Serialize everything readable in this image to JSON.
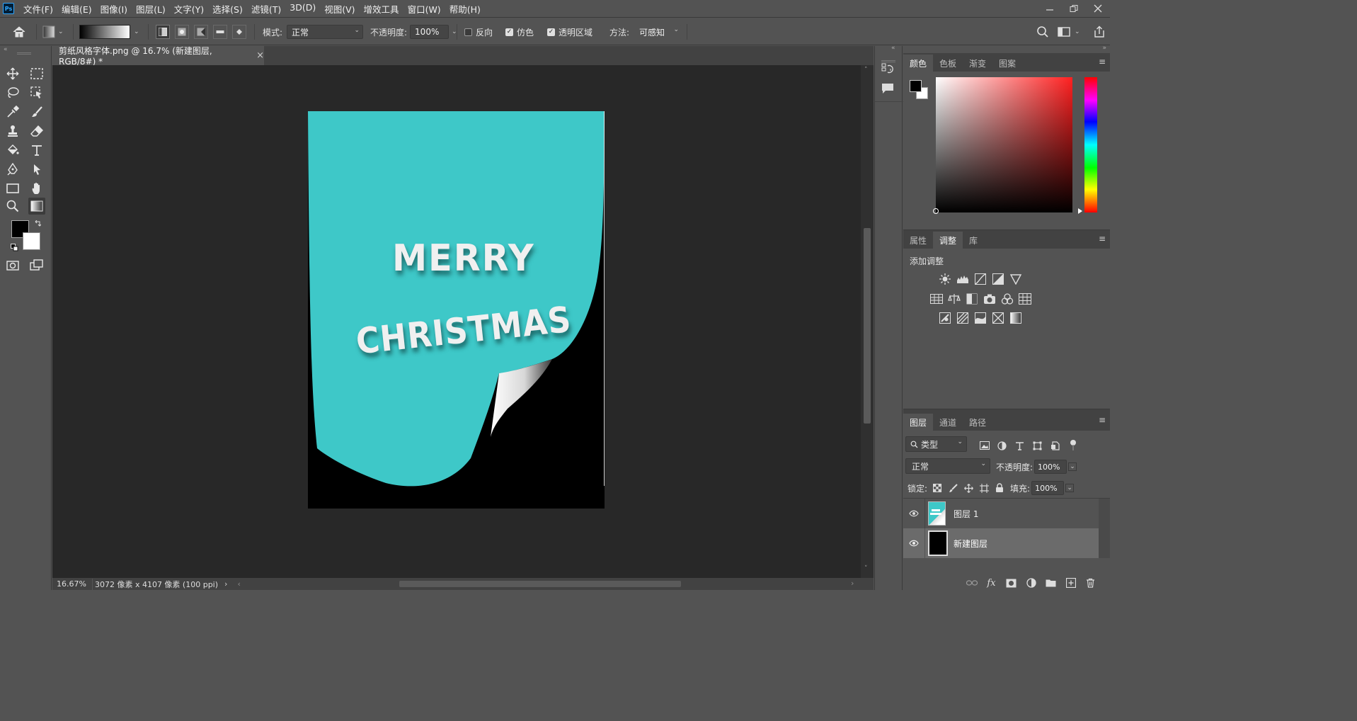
{
  "app": {
    "logo": "Ps"
  },
  "menubar": {
    "items": [
      "文件(F)",
      "编辑(E)",
      "图像(I)",
      "图层(L)",
      "文字(Y)",
      "选择(S)",
      "滤镜(T)",
      "3D(D)",
      "视图(V)",
      "增效工具",
      "窗口(W)",
      "帮助(H)"
    ]
  },
  "options": {
    "mode_label": "模式:",
    "mode_value": "正常",
    "opacity_label": "不透明度:",
    "opacity_value": "100%",
    "reverse_label": "反向",
    "reverse_checked": false,
    "dither_label": "仿色",
    "dither_checked": true,
    "transparency_label": "透明区域",
    "transparency_checked": true,
    "method_label": "方法:",
    "method_value": "可感知"
  },
  "document": {
    "tab_title": "剪纸风格字体.png @ 16.7% (新建图层, RGB/8#) *",
    "close_glyph": "×",
    "artwork_text_line1": "MERRY",
    "artwork_text_line2": "CHRISTMAS",
    "artwork_bg_color": "#000000",
    "artwork_paper_color": "#3ec8c8"
  },
  "status": {
    "zoom": "16.67%",
    "info": "3072 像素 x 4107 像素 (100 ppi)",
    "arrow": "›",
    "left_arrow": "‹",
    "right_arrow": "›"
  },
  "color_panel": {
    "tabs": [
      "颜色",
      "色板",
      "渐变",
      "图案"
    ],
    "active": 0,
    "hue_color": "#ff3b3b"
  },
  "adjust_panel": {
    "tabs": [
      "属性",
      "调整",
      "库"
    ],
    "active": 1,
    "title": "添加调整"
  },
  "layers_panel": {
    "tabs": [
      "图层",
      "通道",
      "路径"
    ],
    "active": 0,
    "filter_value": "类型",
    "blend_value": "正常",
    "opacity_label": "不透明度:",
    "opacity_value": "100%",
    "lock_label": "锁定:",
    "fill_label": "填充:",
    "fill_value": "100%",
    "layers": [
      {
        "name": "图层 1",
        "visible": true,
        "selected": false
      },
      {
        "name": "新建图层",
        "visible": true,
        "selected": true
      }
    ]
  },
  "colors": {
    "foreground": "#000000",
    "background": "#ffffff"
  }
}
